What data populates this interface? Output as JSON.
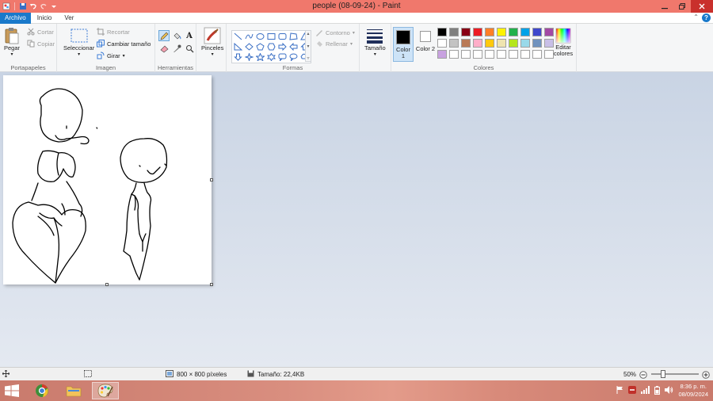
{
  "window": {
    "title": "people (08-09-24) - Paint"
  },
  "tabs": {
    "file": "Archivo",
    "home": "Inicio",
    "view": "Ver"
  },
  "ribbon": {
    "clipboard": {
      "label": "Portapapeles",
      "paste": "Pegar",
      "cut": "Cortar",
      "copy": "Copiar"
    },
    "image": {
      "label": "Imagen",
      "select": "Seleccionar",
      "crop": "Recortar",
      "resize": "Cambiar tamaño",
      "rotate": "Girar"
    },
    "tools": {
      "label": "Herramientas"
    },
    "brushes": {
      "label": "Pinceles"
    },
    "shapes": {
      "label": "Formas",
      "outline": "Contorno",
      "fill": "Rellenar"
    },
    "size": {
      "label": "Tamaño"
    },
    "colors": {
      "label": "Colores",
      "color1": "Color 1",
      "color2": "Color 2",
      "edit": "Editar colores",
      "color1_value": "#000000",
      "color2_value": "#ffffff",
      "palette": [
        "#000000",
        "#7f7f7f",
        "#880015",
        "#ed1c24",
        "#ff7f27",
        "#fff200",
        "#22b14c",
        "#00a2e8",
        "#3f48cc",
        "#a349a4",
        "#ffffff",
        "#c3c3c3",
        "#b97a57",
        "#ffaec9",
        "#ffc90e",
        "#efe4b0",
        "#b5e61d",
        "#99d9ea",
        "#7092be",
        "#c8bfe7",
        "#c8a2e0",
        "#ffffff",
        "#ffffff",
        "#ffffff",
        "#ffffff",
        "#ffffff",
        "#ffffff",
        "#ffffff",
        "#ffffff",
        "#ffffff"
      ]
    }
  },
  "status": {
    "dimensions": "800 × 800 píxeles",
    "filesize": "Tamaño: 22,4KB",
    "zoom": "50%"
  },
  "taskbar": {
    "time": "8:36 p. m.",
    "date": "08/09/2024"
  }
}
